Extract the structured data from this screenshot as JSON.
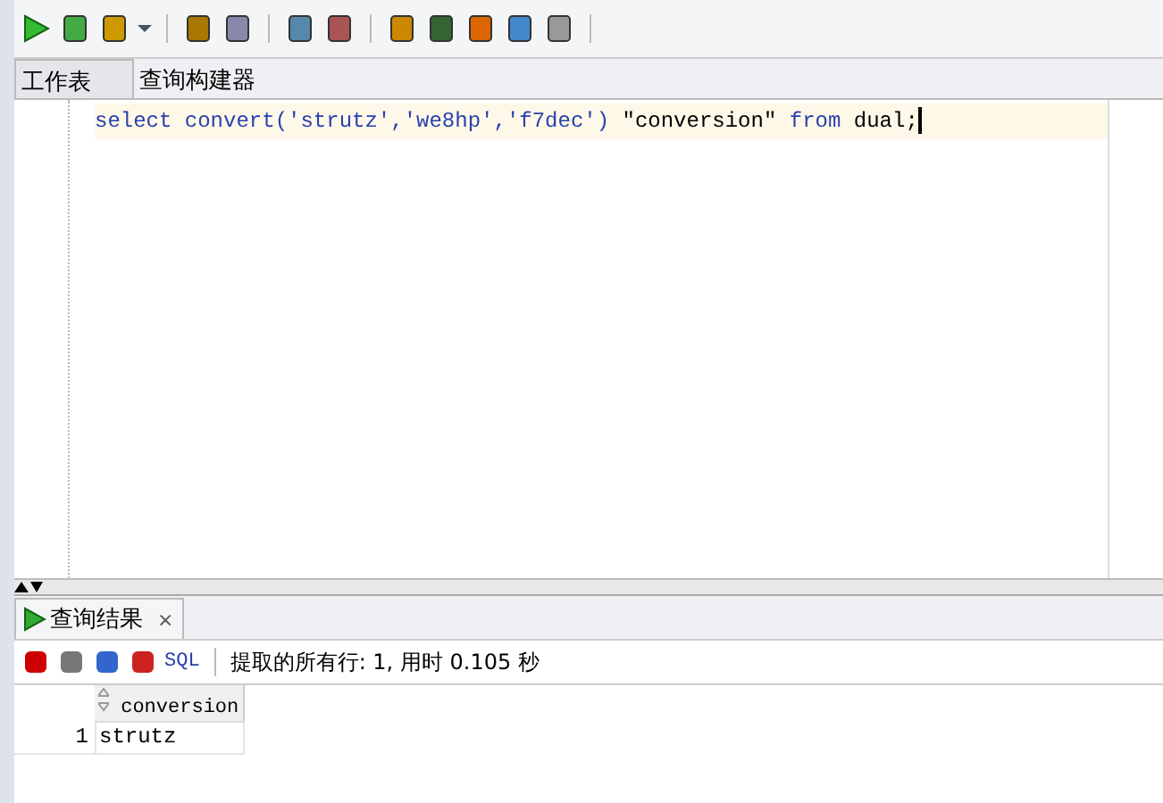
{
  "tabs": [
    {
      "label": "工作表",
      "selected": true
    },
    {
      "label": "查询构建器",
      "selected": false
    }
  ],
  "editor": {
    "segments": [
      {
        "kind": "keyword",
        "text": "select convert('strutz','we8hp','f7dec')"
      },
      {
        "kind": "plain",
        "text": " \"conversion\" "
      },
      {
        "kind": "keyword",
        "text": "from"
      },
      {
        "kind": "plain",
        "text": " dual;"
      }
    ]
  },
  "result_tab": {
    "label": "查询结果",
    "close": "×"
  },
  "result_toolbar": {
    "sql_label": "SQL",
    "status": "提取的所有行: 1, 用时 0.105 秒"
  },
  "grid": {
    "columns": [
      "conversion"
    ],
    "rows": [
      {
        "number": "1",
        "cells": [
          "strutz"
        ]
      }
    ]
  }
}
